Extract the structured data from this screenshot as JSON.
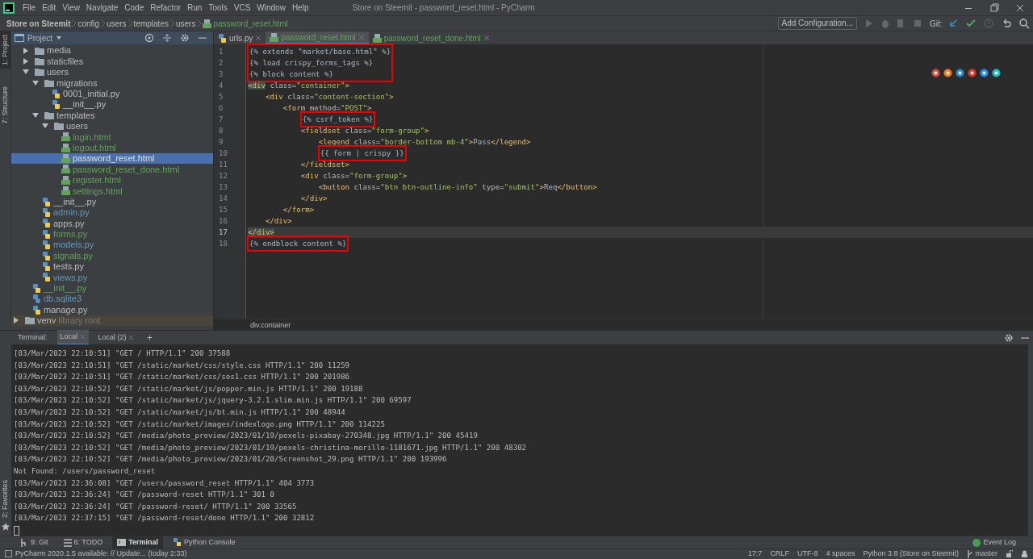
{
  "title_bar": {
    "menus": [
      "File",
      "Edit",
      "View",
      "Navigate",
      "Code",
      "Refactor",
      "Run",
      "Tools",
      "VCS",
      "Window",
      "Help"
    ],
    "title": "Store on Steemit - password_reset.html - PyCharm"
  },
  "breadcrumb": [
    "Store on Steemit",
    "config",
    "users",
    "templates",
    "users",
    "password_reset.html"
  ],
  "toolbar": {
    "configuration": "Add Configuration...",
    "git_label": "Git:"
  },
  "side_strip": [
    {
      "label": "1: Project",
      "selected": true
    },
    {
      "label": "7: Structure",
      "selected": false
    }
  ],
  "side_strip_bottom": [
    {
      "label": "2: Favorites",
      "selected": false
    }
  ],
  "project_panel": {
    "title": "Project",
    "tree": [
      {
        "children": [
          {
            "label": "media",
            "kind": "folder",
            "expanded": false,
            "selected": false
          },
          {
            "label": "staticfiles",
            "kind": "folder",
            "expanded": false,
            "selected": false
          },
          {
            "label": "users",
            "kind": "folder",
            "expanded": true,
            "selected": false,
            "children": [
              {
                "label": "migrations",
                "kind": "folder",
                "expanded": true,
                "selected": false,
                "children": [
                  {
                    "label": "0001_initial.py",
                    "kind": "python",
                    "selected": false
                  },
                  {
                    "label": "__init__.py",
                    "kind": "python",
                    "selected": false
                  }
                ]
              },
              {
                "label": "templates",
                "kind": "folder",
                "expanded": true,
                "selected": false,
                "children": [
                  {
                    "label": "users",
                    "kind": "folder",
                    "expanded": true,
                    "selected": false,
                    "children": [
                      {
                        "label": "login.html",
                        "kind": "html",
                        "color": "#62a35c",
                        "selected": false
                      },
                      {
                        "label": "logout.html",
                        "kind": "html",
                        "color": "#62a35c",
                        "selected": false
                      },
                      {
                        "label": "password_reset.html",
                        "kind": "html",
                        "selected": true
                      },
                      {
                        "label": "password_reset_done.html",
                        "kind": "html",
                        "color": "#62a35c",
                        "selected": false
                      },
                      {
                        "label": "register.html",
                        "kind": "html",
                        "color": "#62a35c",
                        "selected": false
                      },
                      {
                        "label": "settings.html",
                        "kind": "html",
                        "color": "#62a35c",
                        "selected": false
                      }
                    ]
                  }
                ]
              },
              {
                "label": "__init__.py",
                "kind": "python",
                "selected": false
              },
              {
                "label": "admin.py",
                "kind": "python",
                "color": "#6897bb",
                "selected": false
              },
              {
                "label": "apps.py",
                "kind": "python",
                "selected": false
              },
              {
                "label": "forms.py",
                "kind": "python",
                "color": "#62a35c",
                "selected": false
              },
              {
                "label": "models.py",
                "kind": "python",
                "color": "#6897bb",
                "selected": false
              },
              {
                "label": "signals.py",
                "kind": "python",
                "color": "#62a35c",
                "selected": false
              },
              {
                "label": "tests.py",
                "kind": "python",
                "selected": false
              },
              {
                "label": "views.py",
                "kind": "python",
                "color": "#6897bb",
                "selected": false
              }
            ]
          },
          {
            "label": "__init__.py",
            "kind": "python",
            "color": "#62a35c",
            "selected": false
          },
          {
            "label": "db.sqlite3",
            "kind": "database",
            "color": "#6897bb",
            "selected": false
          },
          {
            "label": "manage.py",
            "kind": "python",
            "selected": false
          }
        ]
      },
      {
        "label": "venv",
        "hint": "library root",
        "kind": "library",
        "expanded": false,
        "selected": false
      }
    ]
  },
  "editor": {
    "tabs": [
      {
        "label": "urls.py",
        "kind": "python",
        "selected": false
      },
      {
        "label": "password_reset.html",
        "kind": "html",
        "selected": true
      },
      {
        "label": "password_reset_done.html",
        "kind": "html",
        "selected": false
      }
    ],
    "lines": [
      {
        "number": "1",
        "highlight": true,
        "current": false,
        "segments": [
          {
            "t": "{% extends \"market/base.html\" %}",
            "kind": "tpl"
          }
        ]
      },
      {
        "number": "2",
        "highlight": true,
        "current": false,
        "segments": [
          {
            "t": "{% load crispy_forms_tags %}",
            "kind": "tpl"
          }
        ]
      },
      {
        "number": "3",
        "highlight": true,
        "current": false,
        "segments": [
          {
            "t": "{% block content %}",
            "kind": "tpl"
          }
        ]
      },
      {
        "number": "4",
        "highlight": false,
        "current": false,
        "segments": [
          {
            "t": "<div",
            "kind": "match"
          },
          {
            "t": " class=",
            "kind": "attr"
          },
          {
            "t": "\"container\"",
            "kind": "str"
          },
          {
            "t": ">",
            "kind": "tag"
          }
        ],
        "children": [
          {
            "number": "5",
            "highlight": false,
            "current": false,
            "segments": [
              {
                "t": "<div",
                "kind": "tag"
              },
              {
                "t": " class=",
                "kind": "attr"
              },
              {
                "t": "\"content-section\"",
                "kind": "str"
              },
              {
                "t": ">",
                "kind": "tag"
              }
            ],
            "children": [
              {
                "number": "6",
                "highlight": false,
                "current": false,
                "segments": [
                  {
                    "t": "<form",
                    "kind": "tag"
                  },
                  {
                    "t": " method=",
                    "kind": "attr"
                  },
                  {
                    "t": "\"POST\"",
                    "kind": "str"
                  },
                  {
                    "t": ">",
                    "kind": "tag"
                  }
                ],
                "children": [
                  {
                    "number": "7",
                    "highlight": true,
                    "current": false,
                    "segments": [
                      {
                        "t": "{% csrf_token %}",
                        "kind": "tpl"
                      }
                    ]
                  },
                  {
                    "number": "8",
                    "highlight": false,
                    "current": false,
                    "segments": [
                      {
                        "t": "<fieldset",
                        "kind": "tag"
                      },
                      {
                        "t": " class=",
                        "kind": "attr"
                      },
                      {
                        "t": "\"form-group\"",
                        "kind": "str"
                      },
                      {
                        "t": ">",
                        "kind": "tag"
                      }
                    ],
                    "children": [
                      {
                        "number": "9",
                        "highlight": false,
                        "current": false,
                        "segments": [
                          {
                            "t": "<legend",
                            "kind": "tag"
                          },
                          {
                            "t": " class=",
                            "kind": "attr"
                          },
                          {
                            "t": "\"border-bottom mb-4\"",
                            "kind": "str"
                          },
                          {
                            "t": ">",
                            "kind": "tag"
                          },
                          {
                            "t": "Pass",
                            "kind": "tpl"
                          },
                          {
                            "t": "</legend>",
                            "kind": "tag"
                          }
                        ]
                      },
                      {
                        "number": "10",
                        "highlight": true,
                        "current": false,
                        "segments": [
                          {
                            "t": "{{ form | crispy }}",
                            "kind": "tpl"
                          }
                        ]
                      }
                    ]
                  },
                  {
                    "number": "11",
                    "highlight": false,
                    "current": false,
                    "segments": [
                      {
                        "t": "</fieldset>",
                        "kind": "tag"
                      }
                    ]
                  },
                  {
                    "number": "12",
                    "highlight": false,
                    "current": false,
                    "segments": [
                      {
                        "t": "<div",
                        "kind": "tag"
                      },
                      {
                        "t": " class=",
                        "kind": "attr"
                      },
                      {
                        "t": "\"form-group\"",
                        "kind": "str"
                      },
                      {
                        "t": ">",
                        "kind": "tag"
                      }
                    ],
                    "children": [
                      {
                        "number": "13",
                        "highlight": false,
                        "current": false,
                        "segments": [
                          {
                            "t": "<button",
                            "kind": "tag"
                          },
                          {
                            "t": " class=",
                            "kind": "attr"
                          },
                          {
                            "t": "\"btn btn-outline-info\"",
                            "kind": "str"
                          },
                          {
                            "t": " type=",
                            "kind": "attr"
                          },
                          {
                            "t": "\"submit\"",
                            "kind": "str"
                          },
                          {
                            "t": ">",
                            "kind": "tag"
                          },
                          {
                            "t": "Req",
                            "kind": "tpl"
                          },
                          {
                            "t": "</button>",
                            "kind": "tag"
                          }
                        ]
                      }
                    ]
                  },
                  {
                    "number": "14",
                    "highlight": false,
                    "current": false,
                    "segments": [
                      {
                        "t": "</div>",
                        "kind": "tag"
                      }
                    ]
                  }
                ]
              },
              {
                "number": "15",
                "highlight": false,
                "current": false,
                "segments": [
                  {
                    "t": "</form>",
                    "kind": "tag"
                  }
                ]
              }
            ]
          },
          {
            "number": "16",
            "highlight": false,
            "current": false,
            "segments": [
              {
                "t": "</div>",
                "kind": "tag"
              }
            ]
          }
        ]
      },
      {
        "number": "17",
        "highlight": false,
        "current": true,
        "segments": [
          {
            "t": "</div>",
            "kind": "match"
          }
        ]
      },
      {
        "number": "18",
        "highlight": true,
        "current": false,
        "segments": [
          {
            "t": "{% endblock content %}",
            "kind": "tpl"
          }
        ]
      }
    ],
    "breadcrumb": "div.container"
  },
  "terminal": {
    "label": "Terminal:",
    "tabs": [
      {
        "label": "Local",
        "selected": true
      },
      {
        "label": "Local (2)",
        "selected": false
      }
    ],
    "add": "+",
    "lines": [
      "[03/Mar/2023 22:10:51] \"GET / HTTP/1.1\" 200 37588",
      "[03/Mar/2023 22:10:51] \"GET /static/market/css/style.css HTTP/1.1\" 200 11259",
      "[03/Mar/2023 22:10:51] \"GET /static/market/css/sos1.css HTTP/1.1\" 200 201986",
      "[03/Mar/2023 22:10:52] \"GET /static/market/js/popper.min.js HTTP/1.1\" 200 19188",
      "[03/Mar/2023 22:10:52] \"GET /static/market/js/jquery-3.2.1.slim.min.js HTTP/1.1\" 200 69597",
      "[03/Mar/2023 22:10:52] \"GET /static/market/js/bt.min.js HTTP/1.1\" 200 48944",
      "[03/Mar/2023 22:10:52] \"GET /static/market/images/indexlogo.png HTTP/1.1\" 200 114225",
      "[03/Mar/2023 22:10:52] \"GET /media/photo_preview/2023/01/19/pexels-pixabay-270348.jpg HTTP/1.1\" 200 45419",
      "[03/Mar/2023 22:10:52] \"GET /media/photo_preview/2023/01/19/pexels-christina-morillo-1181671.jpg HTTP/1.1\" 200 48302",
      "[03/Mar/2023 22:10:52] \"GET /media/photo_preview/2023/01/20/Screenshot_29.png HTTP/1.1\" 200 193996",
      "Not Found: /users/password_reset",
      "[03/Mar/2023 22:36:08] \"GET /users/password_reset HTTP/1.1\" 404 3773",
      "[03/Mar/2023 22:36:24] \"GET /password-reset HTTP/1.1\" 301 0",
      "[03/Mar/2023 22:36:24] \"GET /password-reset/ HTTP/1.1\" 200 33565",
      "[03/Mar/2023 22:37:15] \"GET /password-reset/done HTTP/1.1\" 200 32812"
    ]
  },
  "tool_tabs": [
    {
      "label": "9: Git",
      "kind": "git",
      "selected": false
    },
    {
      "label": "6: TODO",
      "kind": "todo",
      "selected": false
    },
    {
      "label": "Terminal",
      "kind": "terminal",
      "selected": true
    },
    {
      "label": "Python Console",
      "kind": "python",
      "selected": false
    }
  ],
  "event_log": "Event Log",
  "status_bar": {
    "message": "PyCharm 2020.1.5 available: // Update... (today 2:33)",
    "items": [
      "17:7",
      "CRLF",
      "UTF-8",
      "4 spaces",
      "Python 3.8 (Store on Steemit)"
    ],
    "branch": "master"
  }
}
